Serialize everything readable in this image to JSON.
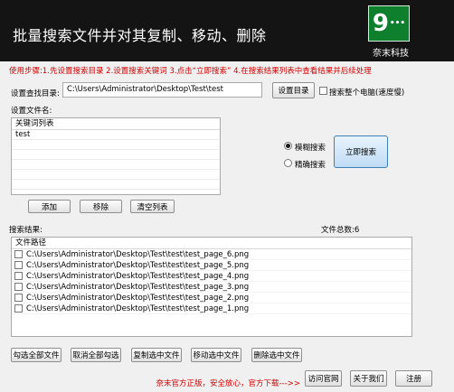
{
  "header": {
    "title": "批量搜索文件并对其复制、移动、删除",
    "logo_text": "9",
    "brand_name": "奈末科技"
  },
  "instruction": "使用步骤:1.先设置搜索目录 2.设置搜索关键词 3.点击“立即搜索” 4.在搜索结果列表中查看结果并后续处理",
  "search_dir": {
    "label": "设置查找目录:",
    "value": "C:\\Users\\Administrator\\Desktop\\Test\\test",
    "button_label": "设置目录",
    "whole_computer_label": "搜索整个电脑(速度慢)"
  },
  "filename": {
    "label": "设置文件名:",
    "list_header": "关键词列表",
    "keywords": [
      "test"
    ],
    "add_label": "添加",
    "remove_label": "移除",
    "clear_label": "清空列表"
  },
  "search_mode": {
    "fuzzy_label": "模糊搜索",
    "exact_label": "精确搜索",
    "selected": "fuzzy",
    "search_button_label": "立即搜索"
  },
  "results": {
    "label": "搜索结果:",
    "total_label": "文件总数:",
    "total_count": "6",
    "column_header": "文件路径",
    "files": [
      "C:\\Users\\Administrator\\Desktop\\Test\\test\\test_page_6.png",
      "C:\\Users\\Administrator\\Desktop\\Test\\test\\test_page_5.png",
      "C:\\Users\\Administrator\\Desktop\\Test\\test\\test_page_4.png",
      "C:\\Users\\Administrator\\Desktop\\Test\\test\\test_page_3.png",
      "C:\\Users\\Administrator\\Desktop\\Test\\test\\test_page_2.png",
      "C:\\Users\\Administrator\\Desktop\\Test\\test\\test_page_1.png"
    ]
  },
  "actions": {
    "select_all": "勾选全部文件",
    "deselect_all": "取消全部勾选",
    "copy_selected": "复制选中文件",
    "move_selected": "移动选中文件",
    "delete_selected": "删除选中文件"
  },
  "footer": {
    "promo_text": "奈末官方正版，安全放心，官方下载--->>",
    "official_site": "访问官网",
    "about": "关于我们",
    "register": "注册"
  },
  "colors": {
    "header_bg": "#141414",
    "logo_green": "#0e7f2d",
    "warning_red": "#d00000",
    "window_bg": "#f0f0f0"
  }
}
